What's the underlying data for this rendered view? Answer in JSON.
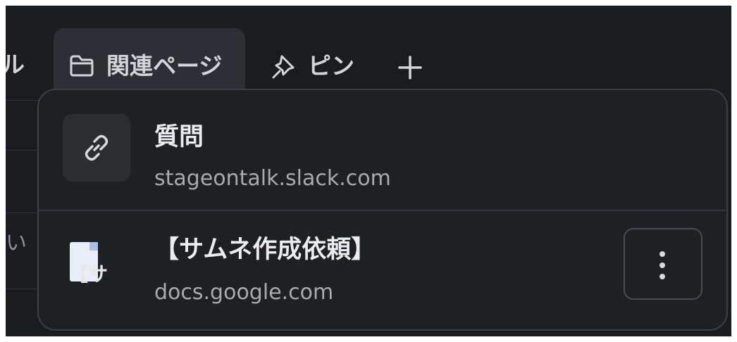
{
  "tabs": {
    "partial_label": "ル",
    "active": {
      "label": "関連ページ",
      "icon": "folder-icon"
    },
    "pin": {
      "label": "ピン",
      "icon": "pin-icon"
    },
    "add_icon": "plus-icon"
  },
  "background": {
    "text": "い"
  },
  "popover": {
    "items": [
      {
        "title": "質問",
        "subtitle": "stageontalk.slack.com",
        "icon": "link-icon"
      },
      {
        "title": "【サムネ作成依頼】",
        "subtitle": "docs.google.com",
        "thumbnail_text": "【サ",
        "icon": "google-docs-thumbnail",
        "action_icon": "more-vertical-icon"
      }
    ]
  },
  "colors": {
    "background": "#1b1c20",
    "popover": "#1f2024",
    "active_tab": "#2e2f34",
    "text_primary": "#ececed",
    "text_secondary": "#a9aaae"
  }
}
